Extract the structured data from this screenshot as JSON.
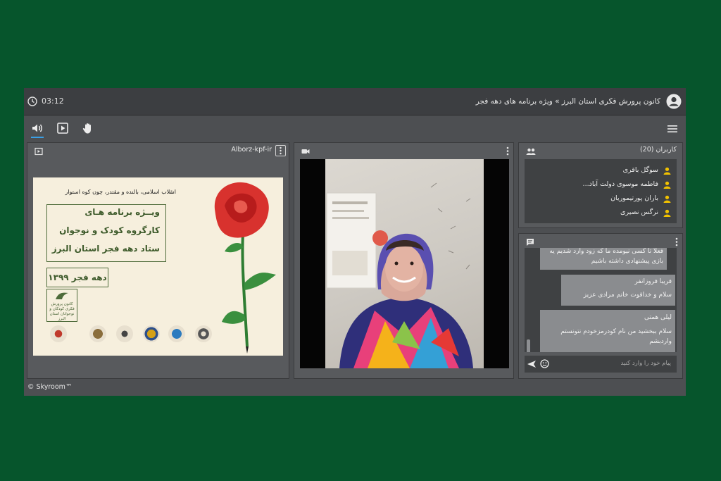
{
  "titlebar": {
    "timer": "03:12",
    "room_title": "کانون پرورش فکری استان البرز » ویژه برنامه های دهه فجر"
  },
  "presentation": {
    "label": "Alborz-kpf-ir",
    "slide": {
      "slogan": "انقلاب اسلامی، بالنده و مقتدر، چون کوه استوار",
      "line1": "ویــژه   برنامه   هـای",
      "line2": "کارگروه کودک و نوجوان",
      "line3": "ستاد دهه فجر استان البرز",
      "date": "دهه فجر ۱۳۹۹",
      "logo_text": "کانون پرورش فکری کودکان و نوجوانان استان البرز"
    }
  },
  "users": {
    "title": "کاربران (20)",
    "list": [
      {
        "name": "سوگل باقری"
      },
      {
        "name": "فاطمه موسوی دولت آباد..."
      },
      {
        "name": "باران پورتیموریان"
      },
      {
        "name": "نرگس نصیری"
      }
    ]
  },
  "chat": {
    "messages": [
      {
        "sender": "",
        "text": "فعلا تا کسی نیومده ما که زود وارد شدیم یه بازی پیشنهادی داشته باشیم"
      },
      {
        "sender": "فریبا فروزانفر",
        "text": "سلام و خداقوت خانم مرادی عزیز"
      },
      {
        "sender": "لیلی همتی",
        "text": "سلام ببخشید من نام کودرمزخودم نتونستم واردبشم"
      }
    ],
    "input_placeholder": "پیام خود را وارد کنید"
  },
  "footer": {
    "brand": "© Skyroom™"
  },
  "colors": {
    "background": "#06552c",
    "app": "#4d4f52",
    "accent": "#3aa0e6",
    "user_icon": "#f2c200"
  }
}
